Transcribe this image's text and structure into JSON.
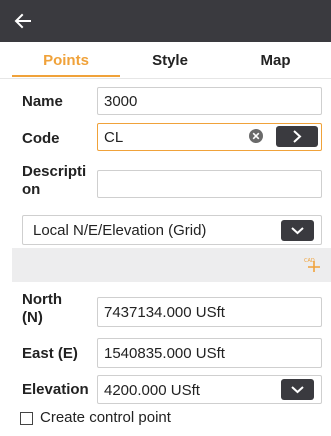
{
  "tabs": [
    {
      "label": "Points",
      "active": true
    },
    {
      "label": "Style",
      "active": false
    },
    {
      "label": "Map",
      "active": false
    }
  ],
  "form": {
    "name": {
      "label": "Name",
      "value": "3000"
    },
    "code": {
      "label": "Code",
      "value": "CL"
    },
    "description": {
      "label": "Description",
      "label_line1": "Descripti",
      "label_line2": "on",
      "value": ""
    },
    "coord_system": {
      "value": "Local N/E/Elevation (Grid)"
    },
    "north": {
      "label": "North (N)",
      "label_line1": "North",
      "label_line2": "(N)",
      "value": "7437134.000 USft"
    },
    "east": {
      "label": "East (E)",
      "value": "1540835.000 USft"
    },
    "elevation": {
      "label": "Elevation",
      "value": "4200.000 USft"
    },
    "create_control": {
      "label": "Create control point",
      "checked": false
    }
  },
  "icons": {
    "back": "arrow-left-icon",
    "clear": "clear-circle-icon",
    "go": "chevron-right-icon",
    "dropdown": "chevron-down-icon",
    "cad": "cad-pick-icon"
  },
  "colors": {
    "accent": "#f0a23a",
    "topbar": "#3a3a3f",
    "band": "#ededee"
  }
}
